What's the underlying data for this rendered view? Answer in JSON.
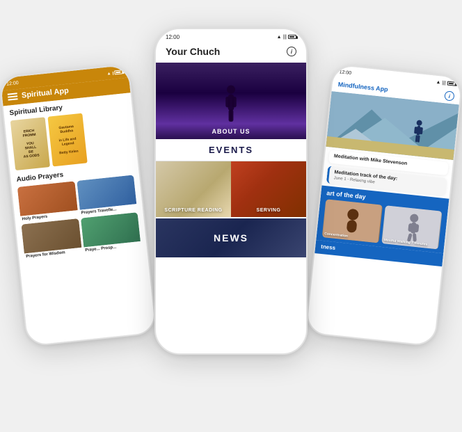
{
  "left_phone": {
    "status_time": "12:00",
    "app_title": "Spiritual App",
    "library_title": "Spiritual Library",
    "books": [
      {
        "author": "ERICH FROMM",
        "title": "YOU SHALL BE AS GODS"
      },
      {
        "author": "Gautama Buddha",
        "title": "in Life and Legend",
        "subtitle": "Betty Kelen"
      }
    ],
    "audio_prayers_title": "Audio Prayers",
    "prayers": [
      {
        "label": "Holy Prayers",
        "color": "brown"
      },
      {
        "label": "Prayers Travelle...",
        "color": "blue"
      },
      {
        "label": "Prayers for Wisdom",
        "color": "tan"
      },
      {
        "label": "Praye... Prosp...",
        "color": "green"
      }
    ]
  },
  "center_phone": {
    "status_time": "12:00",
    "app_title": "Your Chuch",
    "about_us_label": "About us",
    "events_label": "EVENTS",
    "scripture_label": "Scripture reading",
    "serving_label": "Serving",
    "news_label": "News"
  },
  "right_phone": {
    "status_time": "12:00",
    "app_title": "Mindfulness App",
    "meditation_title": "Meditation with Mike Stevenson",
    "track_label": "Meditation track of the day:",
    "track_sub": "June 1 - Relaxing vibe",
    "art_of_day_title": "art of the day",
    "art_cards": [
      {
        "label": "Concentration"
      },
      {
        "label": "Mindful Walking\n7 minutes"
      }
    ],
    "fitness_title": "tness"
  }
}
